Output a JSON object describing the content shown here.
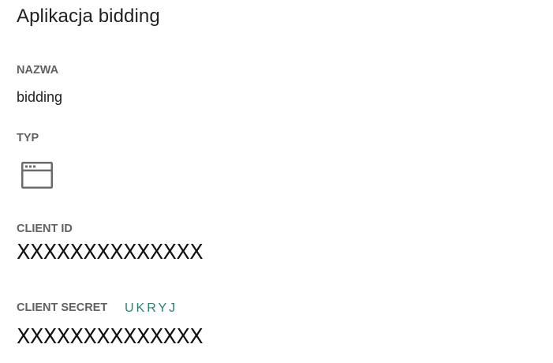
{
  "page": {
    "title": "Aplikacja bidding"
  },
  "fields": {
    "name": {
      "label": "NAZWA",
      "value": "bidding"
    },
    "type": {
      "label": "TYP",
      "icon": "browser-window-icon"
    },
    "client_id": {
      "label": "CLIENT ID",
      "value": "XXXXXXXXXXXXXX"
    },
    "client_secret": {
      "label": "CLIENT SECRET",
      "toggle_label": "UKRYJ",
      "value": "XXXXXXXXXXXXXX"
    }
  },
  "colors": {
    "accent": "#2a7f6f",
    "label": "#616161",
    "text": "#212121"
  }
}
